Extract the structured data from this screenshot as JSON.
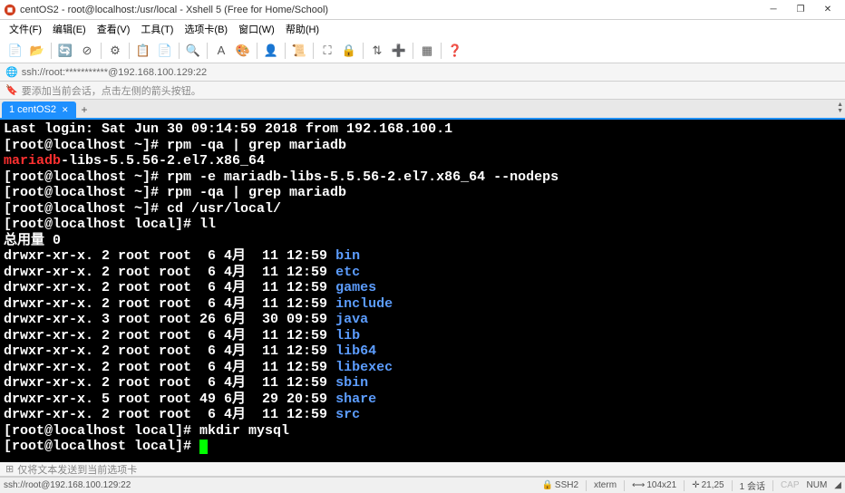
{
  "titlebar": {
    "text": "centOS2 - root@localhost:/usr/local - Xshell 5 (Free for Home/School)"
  },
  "menubar": {
    "items": [
      "文件(F)",
      "编辑(E)",
      "查看(V)",
      "工具(T)",
      "选项卡(B)",
      "窗口(W)",
      "帮助(H)"
    ]
  },
  "addressbar": {
    "text": "ssh://root:***********@192.168.100.129:22"
  },
  "hintbar": {
    "text": "要添加当前会话，点击左侧的箭头按钮。"
  },
  "tab": {
    "label": "1 centOS2"
  },
  "terminal": {
    "line1": "Last login: Sat Jun 30 09:14:59 2018 from 192.168.100.1",
    "line2": "[root@localhost ~]# rpm -qa | grep mariadb",
    "line3a": "mariadb",
    "line3b": "-libs-5.5.56-2.el7.x86_64",
    "line4": "[root@localhost ~]# rpm -e mariadb-libs-5.5.56-2.el7.x86_64 --nodeps",
    "line5": "[root@localhost ~]# rpm -qa | grep mariadb",
    "line6": "[root@localhost ~]# cd /usr/local/",
    "line7": "[root@localhost local]# ll",
    "line8": "总用量 0",
    "ls": [
      {
        "perm": "drwxr-xr-x. 2 root root  6 4月  11 12:59 ",
        "name": "bin"
      },
      {
        "perm": "drwxr-xr-x. 2 root root  6 4月  11 12:59 ",
        "name": "etc"
      },
      {
        "perm": "drwxr-xr-x. 2 root root  6 4月  11 12:59 ",
        "name": "games"
      },
      {
        "perm": "drwxr-xr-x. 2 root root  6 4月  11 12:59 ",
        "name": "include"
      },
      {
        "perm": "drwxr-xr-x. 3 root root 26 6月  30 09:59 ",
        "name": "java"
      },
      {
        "perm": "drwxr-xr-x. 2 root root  6 4月  11 12:59 ",
        "name": "lib"
      },
      {
        "perm": "drwxr-xr-x. 2 root root  6 4月  11 12:59 ",
        "name": "lib64"
      },
      {
        "perm": "drwxr-xr-x. 2 root root  6 4月  11 12:59 ",
        "name": "libexec"
      },
      {
        "perm": "drwxr-xr-x. 2 root root  6 4月  11 12:59 ",
        "name": "sbin"
      },
      {
        "perm": "drwxr-xr-x. 5 root root 49 6月  29 20:59 ",
        "name": "share"
      },
      {
        "perm": "drwxr-xr-x. 2 root root  6 4月  11 12:59 ",
        "name": "src"
      }
    ],
    "line20": "[root@localhost local]# mkdir mysql",
    "line21": "[root@localhost local]# "
  },
  "statusbar_bottom": {
    "hint": "仅将文本发送到当前选项卡"
  },
  "statusbar": {
    "left": "ssh://root@192.168.100.129:22",
    "ssh": "SSH2",
    "term": "xterm",
    "size": "104x21",
    "pos": "21,25",
    "sess": "1 会话",
    "cap": "CAP",
    "num": "NUM"
  }
}
